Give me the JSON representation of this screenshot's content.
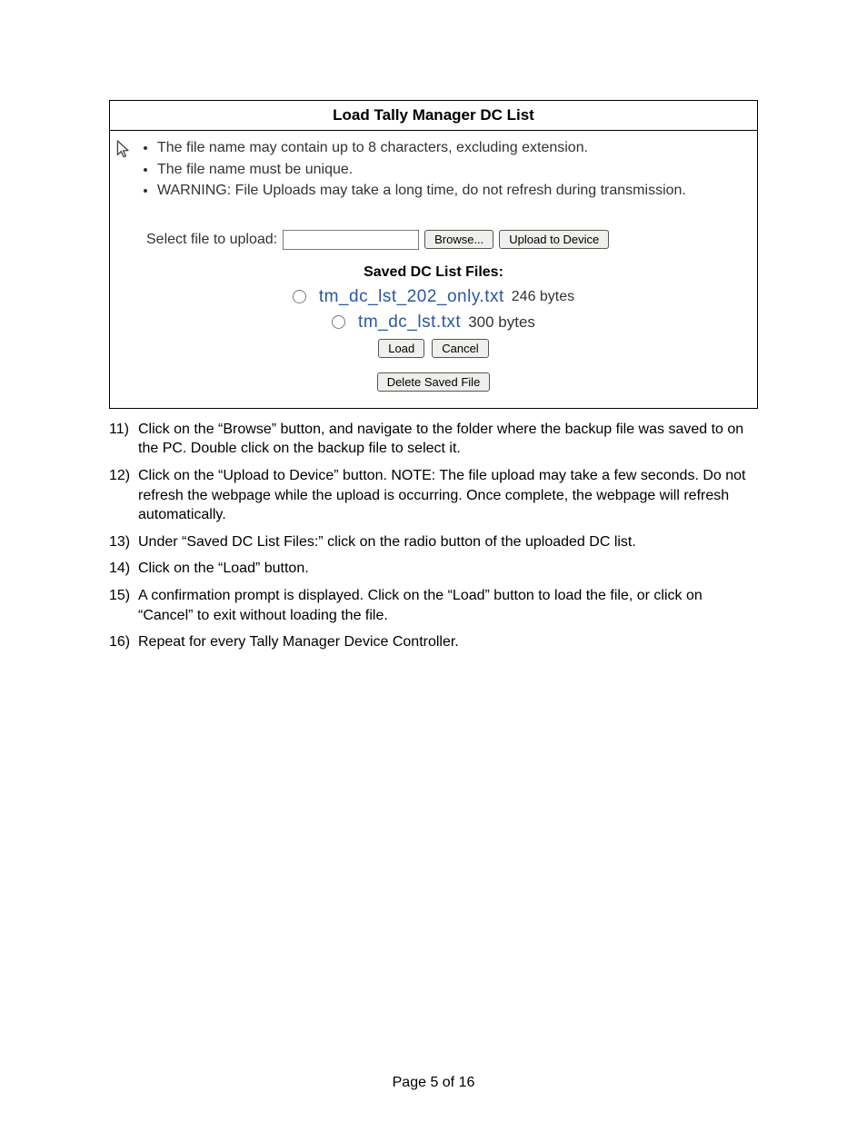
{
  "panel": {
    "title": "Load Tally Manager DC List",
    "bullets": [
      "The file name may contain up to 8 characters, excluding extension.",
      "The file name must be unique.",
      "WARNING: File Uploads may take a long time, do not refresh during transmission."
    ],
    "upload": {
      "label": "Select file to upload:",
      "browse_btn": "Browse...",
      "upload_btn": "Upload to Device"
    },
    "saved": {
      "heading": "Saved DC List Files:",
      "files": [
        {
          "name": "tm_dc_lst_202_only.txt",
          "size": "246 bytes"
        },
        {
          "name": "tm_dc_lst.txt",
          "size": "300 bytes"
        }
      ],
      "load_btn": "Load",
      "cancel_btn": "Cancel",
      "delete_btn": "Delete Saved File"
    }
  },
  "instructions": [
    {
      "n": "11)",
      "t": "Click on the “Browse” button, and navigate to the folder where the backup file was saved to on the PC. Double click on the backup file to select it."
    },
    {
      "n": "12)",
      "t": "Click on the “Upload to Device” button. NOTE: The file upload may take a few seconds. Do not refresh the webpage while the upload is occurring. Once complete, the webpage will refresh automatically."
    },
    {
      "n": "13)",
      "t": "Under “Saved DC List Files:” click on the radio button of the uploaded DC list."
    },
    {
      "n": "14)",
      "t": "Click on the “Load” button."
    },
    {
      "n": "15)",
      "t": "A confirmation prompt is displayed. Click on the “Load” button to load the file, or click on “Cancel” to exit without loading the file."
    },
    {
      "n": "16)",
      "t": "Repeat for every Tally Manager Device Controller."
    }
  ],
  "footer": "Page 5 of 16"
}
